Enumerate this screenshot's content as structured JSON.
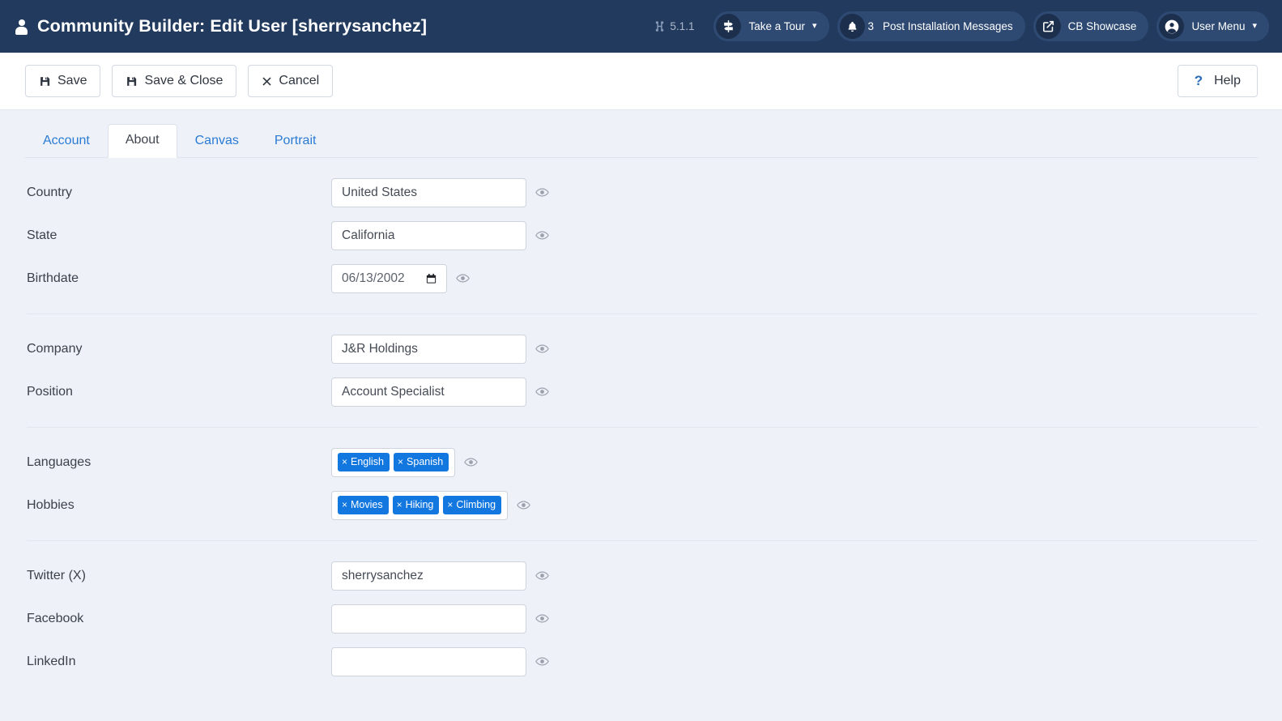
{
  "header": {
    "title": "Community Builder: Edit User [sherrysanchez]",
    "user_icon": "user-icon",
    "joomla_version": "5.1.1",
    "joomla_icon": "joomla-logo-icon",
    "buttons": [
      {
        "label": "Take a Tour",
        "icon": "signpost-icon",
        "caret": "⌄",
        "badge": ""
      },
      {
        "label": "Post Installation Messages",
        "icon": "bell-icon",
        "caret": "",
        "badge": "3"
      },
      {
        "label": "CB Showcase",
        "icon": "external-link-icon",
        "caret": "",
        "badge": ""
      },
      {
        "label": "User Menu",
        "icon": "account-circle-icon",
        "caret": "⌄",
        "badge": ""
      }
    ]
  },
  "toolbar": {
    "save_label": "Save",
    "save_close_label": "Save & Close",
    "cancel_label": "Cancel",
    "help_label": "Help",
    "help_glyph": "?",
    "save_icon": "floppy-disk-icon",
    "cancel_icon": "close-x-icon"
  },
  "tabs": [
    {
      "label": "Account",
      "active": false
    },
    {
      "label": "About",
      "active": true
    },
    {
      "label": "Canvas",
      "active": false
    },
    {
      "label": "Portrait",
      "active": false
    }
  ],
  "groups": [
    {
      "fields": [
        {
          "label": "Country",
          "type": "text",
          "value": "United States",
          "placeholder": "",
          "privacy_icon": "eye-icon"
        },
        {
          "label": "State",
          "type": "text",
          "value": "California",
          "placeholder": "",
          "privacy_icon": "eye-icon"
        },
        {
          "label": "Birthdate",
          "type": "date",
          "value": "06/13/2002",
          "placeholder": "",
          "privacy_icon": "eye-icon",
          "calendar_icon": "calendar-icon"
        }
      ]
    },
    {
      "fields": [
        {
          "label": "Company",
          "type": "text",
          "value": "J&R Holdings",
          "placeholder": "",
          "privacy_icon": "eye-icon"
        },
        {
          "label": "Position",
          "type": "text",
          "value": "Account Specialist",
          "placeholder": "",
          "privacy_icon": "eye-icon"
        }
      ]
    },
    {
      "fields": [
        {
          "label": "Languages",
          "type": "tags",
          "tags": [
            "English",
            "Spanish"
          ],
          "remove_glyph": "×",
          "privacy_icon": "eye-icon"
        },
        {
          "label": "Hobbies",
          "type": "tags",
          "tags": [
            "Movies",
            "Hiking",
            "Climbing"
          ],
          "remove_glyph": "×",
          "privacy_icon": "eye-icon"
        }
      ]
    },
    {
      "fields": [
        {
          "label": "Twitter (X)",
          "type": "text",
          "value": "sherrysanchez",
          "placeholder": "",
          "privacy_icon": "eye-icon"
        },
        {
          "label": "Facebook",
          "type": "text",
          "value": "",
          "placeholder": "",
          "privacy_icon": "eye-icon"
        },
        {
          "label": "LinkedIn",
          "type": "text",
          "value": "",
          "placeholder": "",
          "privacy_icon": "eye-icon"
        }
      ]
    }
  ],
  "colors": {
    "header_bg": "#223a5e",
    "page_bg": "#eef1f8",
    "tag_blue": "#1277de",
    "link_blue": "#2a7bd4"
  }
}
